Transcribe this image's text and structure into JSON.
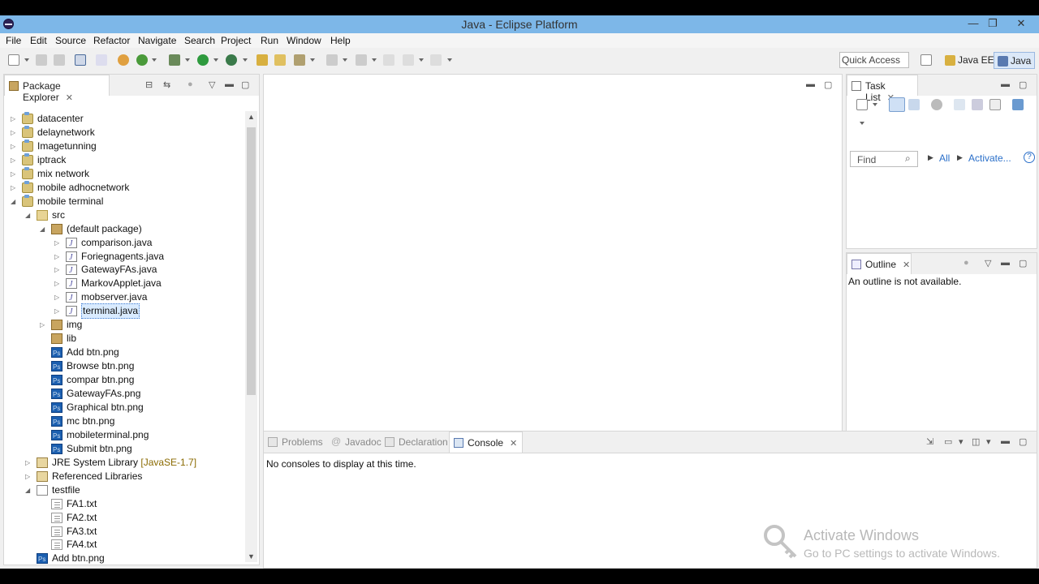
{
  "window": {
    "title": "Java - Eclipse Platform",
    "minimize": "—",
    "restore": "❐",
    "close": "✕"
  },
  "menu": [
    "File",
    "Edit",
    "Source",
    "Refactor",
    "Navigate",
    "Search",
    "Project",
    "Run",
    "Window",
    "Help"
  ],
  "toolbar": {
    "quick_access": "Quick Access",
    "perspectives": [
      "Java EE",
      "Java"
    ]
  },
  "package_explorer": {
    "title": "Package Explorer",
    "tree": [
      {
        "label": "datacenter",
        "level": 0,
        "icon": "project-icon",
        "expanded": false
      },
      {
        "label": "delaynetwork",
        "level": 0,
        "icon": "project-icon",
        "expanded": false
      },
      {
        "label": "Imagetunning",
        "level": 0,
        "icon": "project-icon",
        "expanded": false
      },
      {
        "label": "iptrack",
        "level": 0,
        "icon": "project-icon",
        "expanded": false
      },
      {
        "label": "mix network",
        "level": 0,
        "icon": "project-icon",
        "expanded": false
      },
      {
        "label": "mobile adhocnetwork",
        "level": 0,
        "icon": "project-icon",
        "expanded": false
      },
      {
        "label": "mobile terminal",
        "level": 0,
        "icon": "project-icon",
        "expanded": true
      },
      {
        "label": "src",
        "level": 1,
        "icon": "source-folder-icon",
        "expanded": true
      },
      {
        "label": "(default package)",
        "level": 2,
        "icon": "package-icon",
        "expanded": true
      },
      {
        "label": "comparison.java",
        "level": 3,
        "icon": "java-file-icon",
        "expanded": false
      },
      {
        "label": "Foriegnagents.java",
        "level": 3,
        "icon": "java-file-icon",
        "expanded": false
      },
      {
        "label": "GatewayFAs.java",
        "level": 3,
        "icon": "java-file-icon",
        "expanded": false
      },
      {
        "label": "MarkovApplet.java",
        "level": 3,
        "icon": "java-file-icon",
        "expanded": false
      },
      {
        "label": "mobserver.java",
        "level": 3,
        "icon": "java-file-icon",
        "expanded": false
      },
      {
        "label": "terminal.java",
        "level": 3,
        "icon": "java-file-icon",
        "expanded": false,
        "selected": true
      },
      {
        "label": "img",
        "level": 2,
        "icon": "package-icon",
        "expanded": false
      },
      {
        "label": "lib",
        "level": 2,
        "icon": "package-icon",
        "expanded": null
      },
      {
        "label": "Add btn.png",
        "level": 2,
        "icon": "image-file-icon",
        "expanded": null
      },
      {
        "label": "Browse btn.png",
        "level": 2,
        "icon": "image-file-icon",
        "expanded": null
      },
      {
        "label": "compar btn.png",
        "level": 2,
        "icon": "image-file-icon",
        "expanded": null
      },
      {
        "label": "GatewayFAs.png",
        "level": 2,
        "icon": "image-file-icon",
        "expanded": null
      },
      {
        "label": "Graphical btn.png",
        "level": 2,
        "icon": "image-file-icon",
        "expanded": null
      },
      {
        "label": "mc btn.png",
        "level": 2,
        "icon": "image-file-icon",
        "expanded": null
      },
      {
        "label": "mobileterminal.png",
        "level": 2,
        "icon": "image-file-icon",
        "expanded": null
      },
      {
        "label": "Submit btn.png",
        "level": 2,
        "icon": "image-file-icon",
        "expanded": null
      },
      {
        "label": "JRE System Library",
        "suffix": "[JavaSE-1.7]",
        "level": 1,
        "icon": "library-icon",
        "expanded": false
      },
      {
        "label": "Referenced Libraries",
        "level": 1,
        "icon": "library-icon",
        "expanded": false
      },
      {
        "label": "testfile",
        "level": 1,
        "icon": "folder-icon",
        "expanded": true
      },
      {
        "label": "FA1.txt",
        "level": 2,
        "icon": "text-file-icon",
        "expanded": null
      },
      {
        "label": "FA2.txt",
        "level": 2,
        "icon": "text-file-icon",
        "expanded": null
      },
      {
        "label": "FA3.txt",
        "level": 2,
        "icon": "text-file-icon",
        "expanded": null
      },
      {
        "label": "FA4.txt",
        "level": 2,
        "icon": "text-file-icon",
        "expanded": null
      },
      {
        "label": "Add btn.png",
        "level": 1,
        "icon": "image-file-icon",
        "expanded": null
      }
    ]
  },
  "task_list": {
    "title": "Task List",
    "find_placeholder": "Find",
    "all_label": "All",
    "activate_label": "Activate..."
  },
  "outline": {
    "title": "Outline",
    "message": "An outline is not available."
  },
  "bottom_panel": {
    "tabs": [
      "Problems",
      "Javadoc",
      "Declaration",
      "Console"
    ],
    "active_tab": "Console",
    "message": "No consoles to display at this time."
  },
  "watermark": {
    "title": "Activate Windows",
    "subtitle": "Go to PC settings to activate Windows."
  },
  "colors": {
    "titlebar": "#7db7e8",
    "link": "#2a6fc9",
    "selection": "#d9ebff"
  }
}
